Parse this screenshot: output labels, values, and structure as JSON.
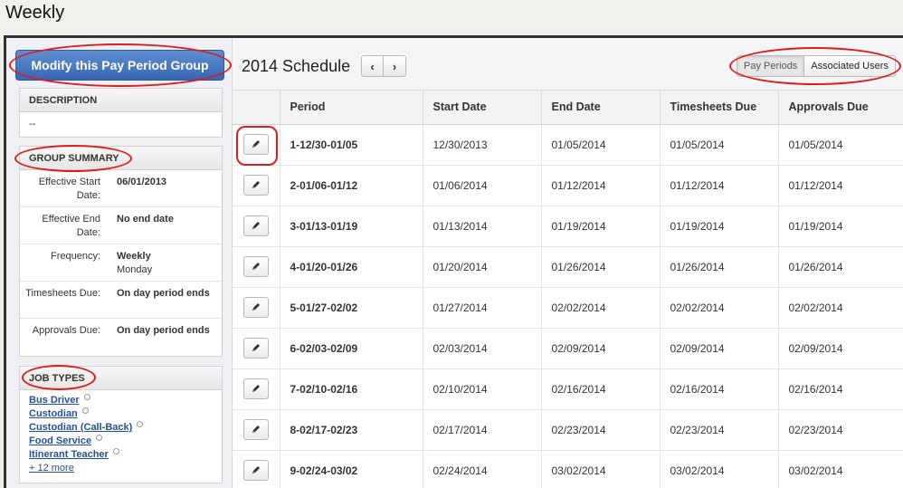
{
  "page": {
    "title": "Weekly"
  },
  "sidebar": {
    "modify_button": "Modify this Pay Period Group",
    "description": {
      "header": "DESCRIPTION",
      "text": "--"
    },
    "group_summary": {
      "header": "GROUP SUMMARY",
      "rows": [
        {
          "label": "Effective Start Date:",
          "value": "06/01/2013",
          "sub": ""
        },
        {
          "label": "Effective End Date:",
          "value": "No end date",
          "sub": ""
        },
        {
          "label": "Frequency:",
          "value": "Weekly",
          "sub": "Monday"
        },
        {
          "label": "Timesheets Due:",
          "value": "On day period ends",
          "sub": ""
        },
        {
          "label": "Approvals Due:",
          "value": "On day period ends",
          "sub": ""
        }
      ]
    },
    "job_types": {
      "header": "JOB TYPES",
      "items": [
        "Bus Driver",
        "Custodian",
        "Custodian (Call-Back)",
        "Food Service",
        "Itinerant Teacher"
      ],
      "more": "+ 12 more"
    }
  },
  "main": {
    "title": "2014 Schedule",
    "prev_label": "‹",
    "next_label": "›",
    "tabs": {
      "pay_periods": "Pay Periods",
      "associated_users": "Associated Users"
    },
    "table": {
      "columns": [
        "",
        "Period",
        "Start Date",
        "End Date",
        "Timesheets Due",
        "Approvals Due"
      ],
      "rows": [
        [
          "1-12/30-01/05",
          "12/30/2013",
          "01/05/2014",
          "01/05/2014",
          "01/05/2014"
        ],
        [
          "2-01/06-01/12",
          "01/06/2014",
          "01/12/2014",
          "01/12/2014",
          "01/12/2014"
        ],
        [
          "3-01/13-01/19",
          "01/13/2014",
          "01/19/2014",
          "01/19/2014",
          "01/19/2014"
        ],
        [
          "4-01/20-01/26",
          "01/20/2014",
          "01/26/2014",
          "01/26/2014",
          "01/26/2014"
        ],
        [
          "5-01/27-02/02",
          "01/27/2014",
          "02/02/2014",
          "02/02/2014",
          "02/02/2014"
        ],
        [
          "6-02/03-02/09",
          "02/03/2014",
          "02/09/2014",
          "02/09/2014",
          "02/09/2014"
        ],
        [
          "7-02/10-02/16",
          "02/10/2014",
          "02/16/2014",
          "02/16/2014",
          "02/16/2014"
        ],
        [
          "8-02/17-02/23",
          "02/17/2014",
          "02/23/2014",
          "02/23/2014",
          "02/23/2014"
        ],
        [
          "9-02/24-03/02",
          "02/24/2014",
          "03/02/2014",
          "03/02/2014",
          "03/02/2014"
        ]
      ]
    }
  },
  "colors": {
    "accent": "#3767b4",
    "highlight": "#e01b1b",
    "link": "#26509c"
  }
}
